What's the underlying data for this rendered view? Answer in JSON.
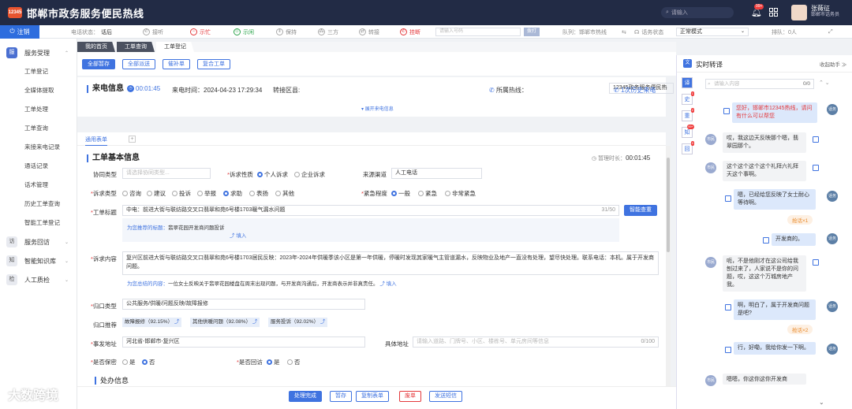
{
  "header": {
    "logo_text": "12345",
    "title": "邯郸市政务服务便民热线",
    "search_placeholder": "请输入",
    "bell_badge": "99+",
    "user_name": "张薇征",
    "user_role": "邯郸市话务员"
  },
  "toolbar": {
    "signin": "注销",
    "phone_status_label": "电话状态：",
    "phone_status": "话后",
    "answer": "接听",
    "busy": "示忙",
    "idle": "示闲",
    "hold": "保持",
    "three_way": "三方",
    "transfer": "转接",
    "hangup": "挂断",
    "phone_placeholder": "请输入号码",
    "call_btn": "拨打",
    "queue": "队列：邯郸市热线",
    "voice_status": "话务状态",
    "mode": "正常模式",
    "rank": "排队：0人"
  },
  "sidebar": {
    "groups": [
      {
        "label": "服务受理",
        "icon": "服",
        "items": [
          "工单登记",
          "全媒体提取",
          "工单处理",
          "工单查询",
          "来接来电记录",
          "通话记录",
          "话术管理",
          "历史工单查询",
          "智能工单登记"
        ]
      },
      {
        "label": "服务回访",
        "icon": "访",
        "items": []
      },
      {
        "label": "智能知识库",
        "icon": "知",
        "items": []
      },
      {
        "label": "人工质检",
        "icon": "检",
        "items": []
      }
    ]
  },
  "tabs": [
    "我的首页",
    "工单查询",
    "工单登记"
  ],
  "actions": [
    "全部暂存",
    "全部派送",
    "催补单",
    "复合工单"
  ],
  "call_info": {
    "title": "来电信息",
    "timer": "00:01:45",
    "call_time_label": "来电时间：",
    "call_time": "2024-04-23 17:29:34",
    "transfer_label": "转接区县:",
    "hotline_label": "所属热线：",
    "hotline": "12345政务服务便民热",
    "history": "1次历史来电",
    "expand": "展开来电信息"
  },
  "form_tabs": {
    "tab": "通用表单",
    "add": "+"
  },
  "form": {
    "title": "工单基本信息",
    "timer_label": "暂理时长：",
    "timer": "00:01:45",
    "coop_label": "协同类型",
    "coop_placeholder": "请选择协同类型...",
    "nature_label": "诉求性质",
    "nature_options": [
      "个人诉求",
      "企业诉求"
    ],
    "source_label": "来源渠道",
    "source": "人工电话",
    "category_label": "诉求类型",
    "categories": [
      "咨询",
      "建议",
      "投诉",
      "举报",
      "求助",
      "表扬",
      "其他"
    ],
    "urgency_label": "紧急程度",
    "urgency_options": [
      "一般",
      "紧急",
      "非常紧急"
    ],
    "subject_label": "工单标题",
    "subject": "中电：前进大街与联纺路交叉口翡翠和苑6号楼1703暖气漏水问题",
    "subject_count": "31/50",
    "smart_btn": "智能查重",
    "subject_hint_label": "为您推荐的标题：",
    "subject_hint": "翡翠花园开发商问题投诉",
    "fill": "填入",
    "content_label": "诉求内容",
    "content": "复兴区前进大街与联纺路交叉口翡翠和苑6号楼1703居民反映：2023年-2024年供暖季该小区是第一年供暖，停暖时发现其家暖气主管道漏水，反映物业及地产一直没有处理，望尽快处理。联系电话：本机。属于开发商问题。",
    "content_hint_label": "为您总结的内容：",
    "content_hint": "一位女士反映关于翡翠花园楼盘在周末出现问题，与开发商沟通后，开发商表示并非真责任。",
    "class_label": "归口类型",
    "class_value": "公共服务/供暖/问题反映/故障报修",
    "rec_label": "归口推荐",
    "recs": [
      "故障报修（92.15%）",
      "其他供暖问题（92.08%）",
      "服务投诉（92.02%）"
    ],
    "addr_label": "事发地址",
    "addr": "河北省-邯郸市-复兴区",
    "detail_label": "具体地址",
    "detail_placeholder": "请输入道路、门牌号、小区、楼栋号、单元房间等信息",
    "detail_count": "0/100",
    "secret_label": "是否保密",
    "secret_options": [
      "是",
      "否"
    ],
    "visit_label": "是否回访",
    "visit_options": [
      "是",
      "否"
    ],
    "section2": "处办信息"
  },
  "bottom": [
    "处理完成",
    "暂存",
    "复制表单",
    "废单",
    "发送短信"
  ],
  "right": {
    "title": "实时转译",
    "collapse": "收起助手",
    "side_tabs": [
      "译",
      "史",
      "重",
      "知",
      "回"
    ],
    "side_badges": [
      "",
      "1",
      "2",
      "99+",
      "0"
    ],
    "search_placeholder": "请输入内容",
    "search_count": "0/0",
    "grab1": "抢话×1",
    "grab2": "抢话×2",
    "avatar_agent": "话务",
    "avatar_cust": "市民",
    "messages": [
      {
        "who": "agent",
        "text": "您好，邯郸市12345热线，请问有什么可以帮您",
        "red": true
      },
      {
        "who": "cust",
        "text": "哎，我这边天反映那个嗯，翡翠园那个。"
      },
      {
        "who": "cust",
        "text": "这个这个这个这个礼拜六礼拜天这个事啊。"
      },
      {
        "who": "agent",
        "text": "嗯，已经给您反映了女士耐心等待啊。"
      },
      {
        "who": "agent",
        "text": "开发商的。"
      },
      {
        "who": "cust",
        "text": "呃，不是他刚才在这公司给我刨过来了，人家说不是你的问题，哎，这这个万城房地产我。"
      },
      {
        "who": "agent",
        "text": "啊，明白了，属于开发商问题是吧?"
      },
      {
        "who": "agent",
        "text": "行，好嘞，我给你发一下啊。"
      },
      {
        "who": "cust",
        "text": "嗯嗯，你这你这你开发商"
      }
    ]
  },
  "watermark": "大数跨境"
}
